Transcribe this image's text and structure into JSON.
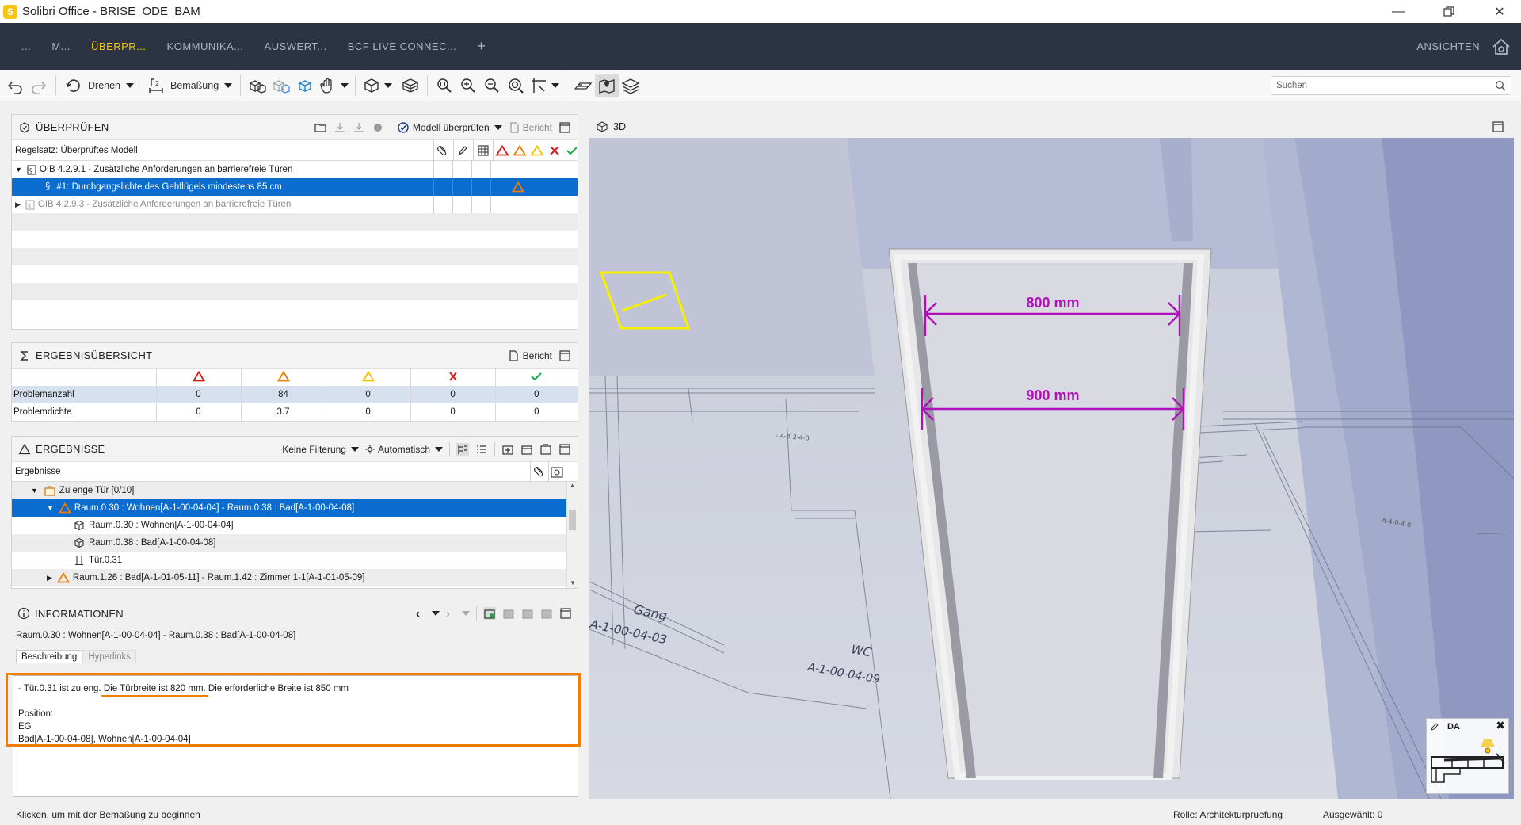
{
  "window": {
    "title": "Solibri Office - BRISE_ODE_BAM",
    "logo_letter": "S"
  },
  "ribbon": {
    "tabs": [
      {
        "label": "...",
        "active": false
      },
      {
        "label": "M...",
        "active": false
      },
      {
        "label": "ÜBERPR...",
        "active": true
      },
      {
        "label": "KOMMUNIKA...",
        "active": false
      },
      {
        "label": "AUSWERT...",
        "active": false
      },
      {
        "label": "BCF LIVE CONNEC...",
        "active": false
      },
      {
        "label": "+",
        "active": false
      }
    ],
    "views_label": "ANSICHTEN"
  },
  "toolbar": {
    "rotate_label": "Drehen",
    "dimension_label": "Bemaßung",
    "search_placeholder": "Suchen"
  },
  "check_panel": {
    "title": "ÜBERPRÜFEN",
    "check_model_label": "Modell überprüfen",
    "report_label": "Bericht",
    "ruleset_label": "Regelsatz: Überprüftes Modell",
    "rows": [
      {
        "label": "OIB 4.2.9.1 - Zusätzliche Anforderungen an barrierefreie Türen",
        "expanded": true
      },
      {
        "label": "#1: Durchgangslichte des Gehflügels mindestens 85 cm",
        "selected": true
      },
      {
        "label": "OIB 4.2.9.3 - Zusätzliche Anforderungen an barrierefreie Türen",
        "expanded": false
      }
    ]
  },
  "summary_panel": {
    "title": "ERGEBNISÜBERSICHT",
    "report_label": "Bericht",
    "rows": [
      {
        "label": "Problemanzahl",
        "values": [
          "0",
          "84",
          "0",
          "0",
          "0"
        ]
      },
      {
        "label": "Problemdichte",
        "values": [
          "0",
          "3.7",
          "0",
          "0",
          "0"
        ]
      }
    ]
  },
  "results_panel": {
    "title": "ERGEBNISSE",
    "filter_label": "Keine Filterung",
    "auto_label": "Automatisch",
    "column_header": "Ergebnisse",
    "rows": [
      {
        "label": "Zu enge Tür [0/10]"
      },
      {
        "label": "Raum.0.30 : Wohnen[A-1-00-04-04] - Raum.0.38 : Bad[A-1-00-04-08]"
      },
      {
        "label": "Raum.0.30 : Wohnen[A-1-00-04-04]"
      },
      {
        "label": "Raum.0.38 : Bad[A-1-00-04-08]"
      },
      {
        "label": "Tür.0.31"
      },
      {
        "label": "Raum.1.26 : Bad[A-1-01-05-11] - Raum.1.42 : Zimmer 1-1[A-1-01-05-09]"
      }
    ]
  },
  "info_panel": {
    "title": "INFORMATIONEN",
    "subject": "Raum.0.30 : Wohnen[A-1-00-04-04] - Raum.0.38 : Bad[A-1-00-04-08]",
    "tab_description": "Beschreibung",
    "tab_hyperlinks": "Hyperlinks",
    "desc_part1": "- Tür.0.31 ist zu eng. ",
    "desc_part2": "Die Türbreite ist 820 mm.",
    "desc_part3": " Die erforderliche Breite ist 850 mm",
    "position_label": "Position:",
    "floor": "EG",
    "rooms": "Bad[A-1-00-04-08], Wohnen[A-1-00-04-04]"
  },
  "viewport": {
    "title": "3D",
    "dim_top": "800 mm",
    "dim_bottom": "900 mm",
    "label_gang": "Gang",
    "label_gang_id": "A-1-00-04-03",
    "label_wc": "WC",
    "label_wc_id": "A-1-00-04-09",
    "minimap_label": "DA",
    "colors": {
      "dimension": "#b010b8",
      "marker": "#f5f000",
      "highlight": "#f07d00"
    }
  },
  "status": {
    "hint": "Klicken, um mit der Bemaßung zu beginnen",
    "role": "Rolle: Architekturpruefung",
    "selected": "Ausgewählt: 0"
  }
}
